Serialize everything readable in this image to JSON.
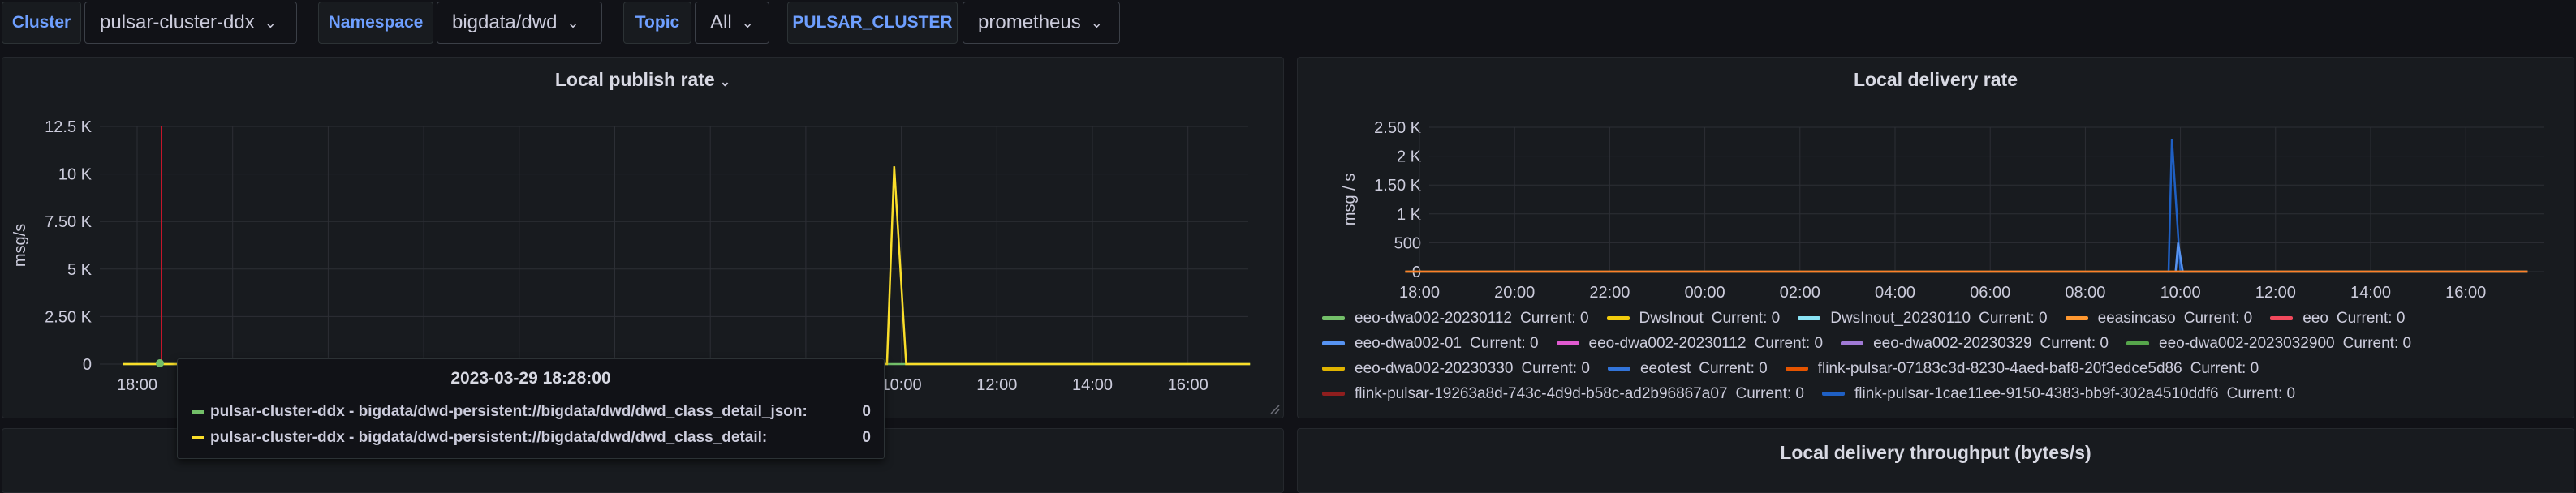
{
  "variables": [
    {
      "label": "Cluster",
      "value": "pulsar-cluster-ddx"
    },
    {
      "label": "Namespace",
      "value": "bigdata/dwd"
    },
    {
      "label": "Topic",
      "value": "All"
    },
    {
      "label": "PULSAR_CLUSTER",
      "value": "prometheus"
    }
  ],
  "panels": {
    "publish": {
      "title": "Local publish rate"
    },
    "delivery": {
      "title": "Local delivery rate"
    },
    "throughput": {
      "title": "Local delivery throughput (bytes/s)"
    }
  },
  "chart_data": [
    {
      "type": "line",
      "title": "Local publish rate",
      "ylabel": "msg/s",
      "y_ticks": [
        "0",
        "2.50 K",
        "5 K",
        "7.50 K",
        "10 K",
        "12.5 K"
      ],
      "x_ticks": [
        "18:00",
        "20:00",
        "22:00",
        "00:00",
        "02:00",
        "04:00",
        "06:00",
        "08:00",
        "10:00",
        "12:00",
        "14:00",
        "16:00"
      ],
      "ylim": [
        0,
        12500
      ],
      "grid": true,
      "series": [
        {
          "name": "pulsar-cluster-ddx - bigdata/dwd-persistent://bigdata/dwd/dwd_class_detail_json:",
          "color": "#73bf69",
          "points": [
            [
              -0.3,
              0
            ],
            [
              23.3,
              0
            ]
          ]
        },
        {
          "name": "pulsar-cluster-ddx - bigdata/dwd-persistent://bigdata/dwd/dwd_class_detail:",
          "color": "#fade2a",
          "points": [
            [
              -0.3,
              0
            ],
            [
              15.7,
              0
            ],
            [
              15.85,
              10400
            ],
            [
              16.1,
              0
            ],
            [
              23.3,
              0
            ]
          ]
        }
      ],
      "tooltip": {
        "time": "2023-03-29 18:28:00",
        "rows": [
          {
            "name": "pulsar-cluster-ddx - bigdata/dwd-persistent://bigdata/dwd/dwd_class_detail_json:",
            "value": "0",
            "color": "#73bf69"
          },
          {
            "name": "pulsar-cluster-ddx - bigdata/dwd-persistent://bigdata/dwd/dwd_class_detail:",
            "value": "0",
            "color": "#fade2a"
          }
        ]
      }
    },
    {
      "type": "line",
      "title": "Local delivery rate",
      "ylabel": "msg / s",
      "y_ticks": [
        "0",
        "500",
        "1 K",
        "1.50 K",
        "2 K",
        "2.50 K"
      ],
      "x_ticks": [
        "18:00",
        "20:00",
        "22:00",
        "00:00",
        "02:00",
        "04:00",
        "06:00",
        "08:00",
        "10:00",
        "12:00",
        "14:00",
        "16:00"
      ],
      "ylim": [
        0,
        2500
      ],
      "grid": true,
      "series_spikes": [
        {
          "name": "flink-pulsar-1cae11ee-9150-4383-bb9f-302a4510ddf6",
          "color": "#1f60c4",
          "points": [
            [
              -0.3,
              0
            ],
            [
              15.75,
              0
            ],
            [
              15.82,
              2300
            ],
            [
              16.0,
              0
            ],
            [
              23.3,
              0
            ]
          ]
        },
        {
          "name": "eeotest",
          "color": "#5794f2",
          "points": [
            [
              15.9,
              0
            ],
            [
              15.95,
              500
            ],
            [
              16.05,
              0
            ],
            [
              23.3,
              0
            ]
          ]
        },
        {
          "name": "eeo-dwa002-20230330",
          "color": "#e0b400",
          "points": [
            [
              -0.3,
              0
            ],
            [
              23.3,
              0
            ]
          ]
        },
        {
          "name": "eeasincaso",
          "color": "#ff7f2a",
          "points": [
            [
              -0.3,
              0
            ],
            [
              23.3,
              0
            ]
          ]
        }
      ],
      "legend": [
        [
          {
            "name": "eeo-dwa002-20230112",
            "current": "Current: 0",
            "color": "#73bf69"
          },
          {
            "name": "DwsInout",
            "current": "Current: 0",
            "color": "#f2cc0c"
          },
          {
            "name": "DwsInout_20230110",
            "current": "Current: 0",
            "color": "#8ae3f5"
          },
          {
            "name": "eeasincaso",
            "current": "Current: 0",
            "color": "#ff9830"
          },
          {
            "name": "eeo",
            "current": "Current: 0",
            "color": "#f2495c"
          }
        ],
        [
          {
            "name": "eeo-dwa002-01",
            "current": "Current: 0",
            "color": "#5794f2"
          },
          {
            "name": "eeo-dwa002-20230112",
            "current": "Current: 0",
            "color": "#e05ad0"
          },
          {
            "name": "eeo-dwa002-20230329",
            "current": "Current: 0",
            "color": "#a07ad6"
          },
          {
            "name": "eeo-dwa002-2023032900",
            "current": "Current: 0",
            "color": "#56a64b"
          }
        ],
        [
          {
            "name": "eeo-dwa002-20230330",
            "current": "Current: 0",
            "color": "#e0b400"
          },
          {
            "name": "eeotest",
            "current": "Current: 0",
            "color": "#3274d9"
          },
          {
            "name": "flink-pulsar-07183c3d-8230-4aed-baf8-20f3edce5d86",
            "current": "Current: 0",
            "color": "#e55400"
          }
        ],
        [
          {
            "name": "flink-pulsar-19263a8d-743c-4d9d-b58c-ad2b96867a07",
            "current": "Current: 0",
            "color": "#8f1e1e"
          },
          {
            "name": "flink-pulsar-1cae11ee-9150-4383-bb9f-302a4510ddf6",
            "current": "Current: 0",
            "color": "#1f60c4"
          }
        ]
      ]
    }
  ]
}
